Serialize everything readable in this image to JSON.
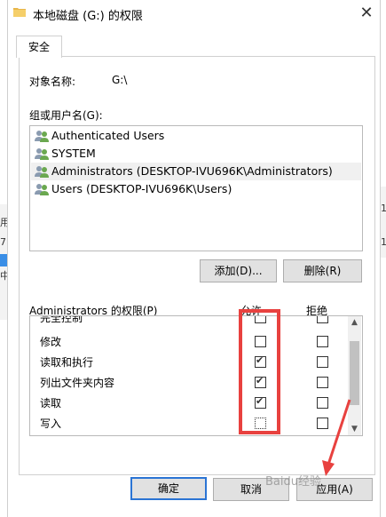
{
  "window": {
    "title": "本地磁盘 (G:) 的权限",
    "close_glyph": "✕"
  },
  "tabs": [
    {
      "label": "安全"
    }
  ],
  "object": {
    "label": "对象名称:",
    "value": "G:\\"
  },
  "groups": {
    "label": "组或用户名(G):",
    "users": [
      {
        "name": "Authenticated Users",
        "selected": false
      },
      {
        "name": "SYSTEM",
        "selected": false
      },
      {
        "name": "Administrators (DESKTOP-IVU696K\\Administrators)",
        "selected": true
      },
      {
        "name": "Users (DESKTOP-IVU696K\\Users)",
        "selected": false
      }
    ],
    "add_label": "添加(D)...",
    "remove_label": "删除(R)"
  },
  "permissions": {
    "label": "Administrators 的权限(P)",
    "allow_header": "允许",
    "deny_header": "拒绝",
    "rows": [
      {
        "name": "完全控制",
        "allow": false,
        "deny": false
      },
      {
        "name": "修改",
        "allow": false,
        "deny": false
      },
      {
        "name": "读取和执行",
        "allow": true,
        "deny": false
      },
      {
        "name": "列出文件夹内容",
        "allow": true,
        "deny": false
      },
      {
        "name": "读取",
        "allow": true,
        "deny": false
      },
      {
        "name": "写入",
        "allow": false,
        "deny": false
      }
    ]
  },
  "footer": {
    "ok_label": "确定",
    "cancel_label": "取消",
    "apply_label": "应用(A)"
  },
  "background": {
    "left_fragments": [
      "用",
      "7",
      "中"
    ],
    "right_fragments": [
      "1",
      "1"
    ]
  },
  "watermark": "Baidu经验",
  "colors": {
    "accent": "#2b74d4",
    "highlight": "#e8413f",
    "selection": "#f0f0f0"
  },
  "icons": [
    "folder-icon",
    "close-icon",
    "users-icon",
    "checkbox-icon",
    "scroll-up-icon",
    "scroll-down-icon"
  ]
}
